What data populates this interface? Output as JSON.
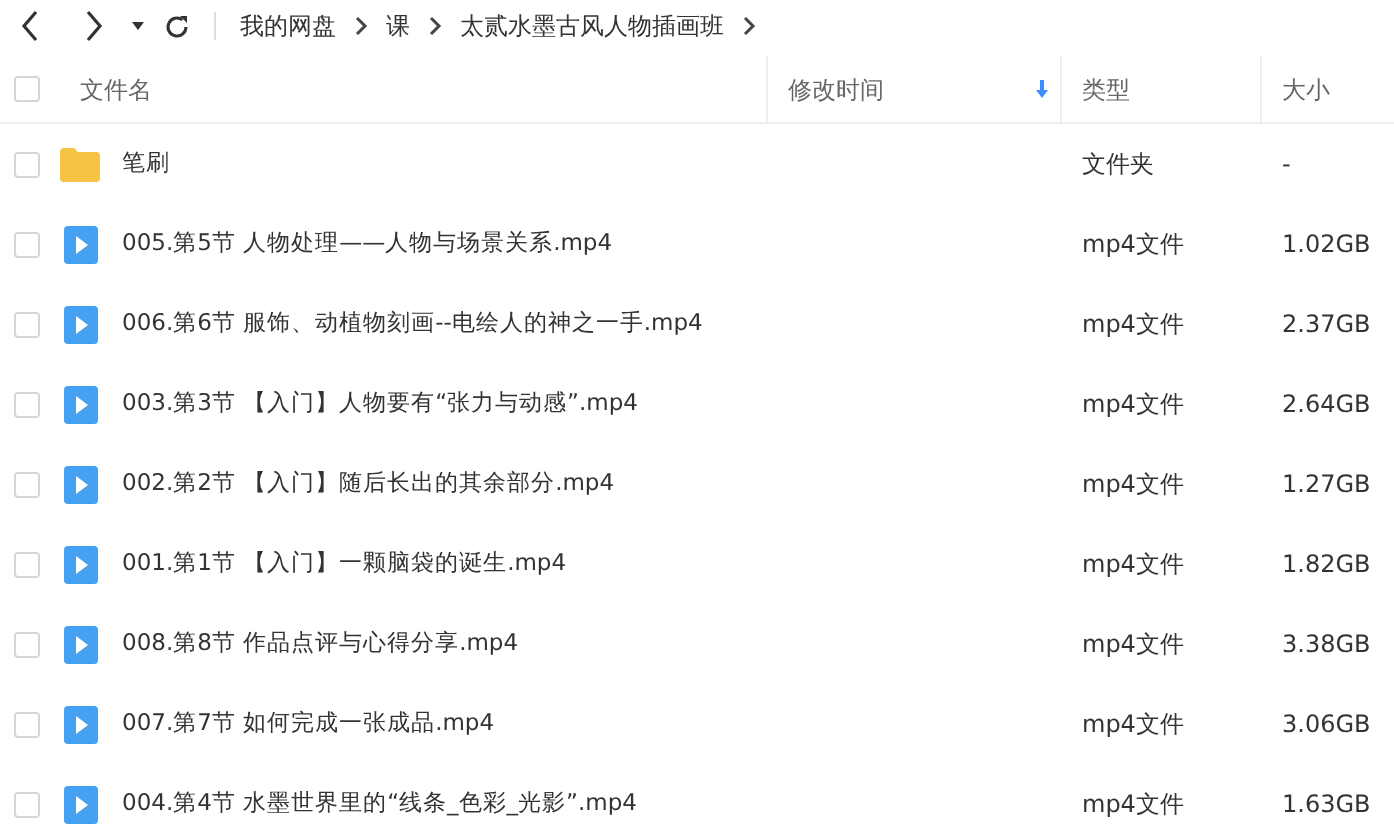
{
  "breadcrumb": [
    "我的网盘",
    "课",
    "太贰水墨古风人物插画班"
  ],
  "columns": [
    {
      "label": "文件名",
      "sorted": false
    },
    {
      "label": "修改时间",
      "sorted": true
    },
    {
      "label": "类型",
      "sorted": false
    },
    {
      "label": "大小",
      "sorted": false
    }
  ],
  "header_checked": false,
  "rows": [
    {
      "kind": "folder",
      "name": "笔刷",
      "type": "文件夹",
      "size": "-",
      "checked": false
    },
    {
      "kind": "video",
      "name": "005.第5节 人物处理——人物与场景关系.mp4",
      "type": "mp4文件",
      "size": "1.02GB",
      "checked": false
    },
    {
      "kind": "video",
      "name": "006.第6节 服饰、动植物刻画--电绘人的神之一手.mp4",
      "type": "mp4文件",
      "size": "2.37GB",
      "checked": false
    },
    {
      "kind": "video",
      "name": "003.第3节 【入门】人物要有“张力与动感”.mp4",
      "type": "mp4文件",
      "size": "2.64GB",
      "checked": false
    },
    {
      "kind": "video",
      "name": "002.第2节 【入门】随后长出的其余部分.mp4",
      "type": "mp4文件",
      "size": "1.27GB",
      "checked": false
    },
    {
      "kind": "video",
      "name": "001.第1节 【入门】一颗脑袋的诞生.mp4",
      "type": "mp4文件",
      "size": "1.82GB",
      "checked": false
    },
    {
      "kind": "video",
      "name": "008.第8节 作品点评与心得分享.mp4",
      "type": "mp4文件",
      "size": "3.38GB",
      "checked": false
    },
    {
      "kind": "video",
      "name": "007.第7节 如何完成一张成品.mp4",
      "type": "mp4文件",
      "size": "3.06GB",
      "checked": false
    },
    {
      "kind": "video",
      "name": "004.第4节 水墨世界里的“线条_色彩_光影”.mp4",
      "type": "mp4文件",
      "size": "1.63GB",
      "checked": false
    }
  ]
}
